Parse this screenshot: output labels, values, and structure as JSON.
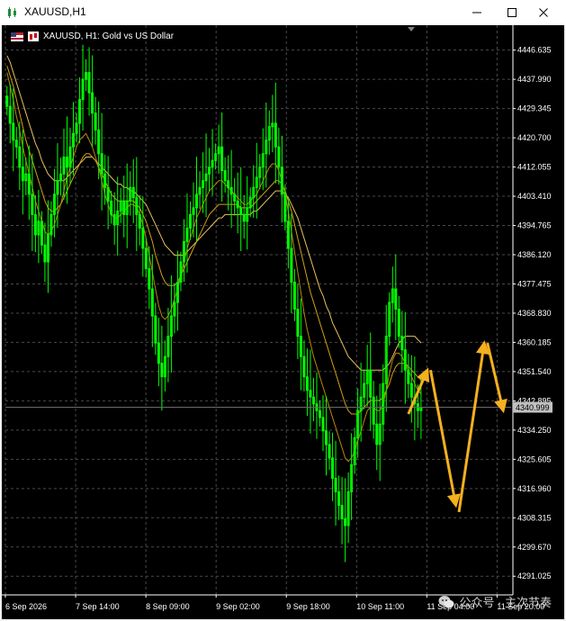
{
  "window": {
    "title": "XAUUSD,H1",
    "icons": {
      "app": "candlestick-chart-icon",
      "minimize": "minimize-icon",
      "maximize": "maximize-icon",
      "close": "close-icon"
    }
  },
  "chart_info": {
    "text": "XAUUSD, H1:  Gold vs US Dollar",
    "icons": [
      "flag-icon",
      "chart-type-icon"
    ]
  },
  "watermark": {
    "text": "公众号 · 主次节奏",
    "icon": "wechat-icon"
  },
  "colors": {
    "background": "#000000",
    "grid": "#4a4a4a",
    "candle": "#00ff00",
    "ma_fast": "#b8860b",
    "ma_mid": "#d2a017",
    "ma_slow": "#e8c060",
    "arrow": "#f5b01f",
    "axis_text": "#ffffff",
    "price_tag_bg": "#c0c0c0",
    "price_tag_text": "#000000",
    "current_line": "#6a6a6a"
  },
  "chart_data": {
    "type": "candlestick",
    "symbol": "XAUUSD",
    "timeframe": "H1",
    "y_ticks": [
      4446.635,
      4437.99,
      4429.345,
      4420.7,
      4412.055,
      4403.41,
      4394.765,
      4386.12,
      4377.475,
      4368.83,
      4360.185,
      4351.54,
      4342.895,
      4334.25,
      4325.605,
      4316.96,
      4308.315,
      4299.67,
      4291.025
    ],
    "y_tick_labels": [
      "4446.635",
      "4437.990",
      "4429.345",
      "4420.700",
      "4412.055",
      "4403.410",
      "4394.765",
      "4386.120",
      "4377.475",
      "4368.830",
      "4360.185",
      "4351.540",
      "4342.895",
      "4334.250",
      "4325.605",
      "4316.960",
      "4308.315",
      "4299.670",
      "4291.025"
    ],
    "ylim": [
      4285.5,
      4454.0
    ],
    "x_labels": [
      "6 Sep 2026",
      "7 Sep 14:00",
      "8 Sep 09:00",
      "9 Sep 02:00",
      "9 Sep 18:00",
      "10 Sep 11:00",
      "11 Sep 04:00",
      "11 Sep 20:00"
    ],
    "current_price": 4340.999,
    "current_price_label": "4340.999",
    "close": [
      4430,
      4425,
      4420,
      4418,
      4412,
      4408,
      4410,
      4404,
      4398,
      4392,
      4396,
      4389,
      4384,
      4392,
      4398,
      4404,
      4408,
      4410,
      4415,
      4412,
      4418,
      4422,
      4425,
      4432,
      4438,
      4440,
      4434,
      4428,
      4423,
      4416,
      4410,
      4406,
      4402,
      4398,
      4395,
      4399,
      4402,
      4398,
      4402,
      4406,
      4403,
      4398,
      4394,
      4388,
      4382,
      4376,
      4368,
      4360,
      4354,
      4350,
      4356,
      4362,
      4368,
      4372,
      4378,
      4384,
      4390,
      4394,
      4398,
      4400,
      4404,
      4406,
      4408,
      4410,
      4412,
      4414,
      4416,
      4418,
      4411,
      4408,
      4406,
      4404,
      4402,
      4400,
      4398,
      4396,
      4400,
      4403,
      4406,
      4409,
      4412,
      4416,
      4420,
      4424,
      4425,
      4418,
      4412,
      4404,
      4396,
      4388,
      4378,
      4370,
      4362,
      4356,
      4350,
      4346,
      4344,
      4342,
      4340,
      4338,
      4334,
      4330,
      4326,
      4320,
      4316,
      4312,
      4308,
      4306,
      4316,
      4324,
      4332,
      4340,
      4344,
      4348,
      4352,
      4344,
      4336,
      4330,
      4336,
      4348,
      4362,
      4372,
      4376,
      4370,
      4362,
      4358,
      4352,
      4348,
      4344,
      4342,
      4340,
      4341
    ],
    "ma_fast": [
      4440,
      4436,
      4432,
      4427,
      4423,
      4418,
      4414,
      4410,
      4406,
      4402,
      4399,
      4396,
      4393,
      4392,
      4393,
      4395,
      4398,
      4401,
      4405,
      4409,
      4412,
      4415,
      4418,
      4420,
      4421,
      4422,
      4420,
      4418,
      4415,
      4412,
      4408,
      4404,
      4401,
      4398,
      4397,
      4397,
      4398,
      4399,
      4400,
      4401,
      4401,
      4400,
      4398,
      4395,
      4391,
      4386,
      4381,
      4376,
      4371,
      4368,
      4367,
      4368,
      4370,
      4373,
      4376,
      4380,
      4384,
      4388,
      4391,
      4394,
      4397,
      4399,
      4401,
      4403,
      4405,
      4406,
      4407,
      4408,
      4408,
      4407,
      4406,
      4405,
      4404,
      4403,
      4402,
      4401,
      4401,
      4402,
      4403,
      4404,
      4406,
      4408,
      4410,
      4412,
      4413,
      4413,
      4411,
      4408,
      4404,
      4399,
      4393,
      4387,
      4381,
      4375,
      4369,
      4364,
      4360,
      4356,
      4353,
      4350,
      4347,
      4344,
      4341,
      4338,
      4335,
      4332,
      4329,
      4326,
      4325,
      4326,
      4328,
      4331,
      4334,
      4337,
      4340,
      4341,
      4341,
      4340,
      4340,
      4342,
      4346,
      4351,
      4355,
      4357,
      4357,
      4356,
      4354,
      4352,
      4350,
      4348,
      4346,
      4345
    ],
    "ma_mid": [
      4442,
      4439,
      4436,
      4432,
      4428,
      4424,
      4420,
      4417,
      4414,
      4411,
      4408,
      4405,
      4402,
      4400,
      4399,
      4399,
      4400,
      4401,
      4403,
      4405,
      4407,
      4409,
      4411,
      4413,
      4415,
      4416,
      4416,
      4415,
      4414,
      4412,
      4410,
      4408,
      4406,
      4404,
      4403,
      4402,
      4402,
      4402,
      4402,
      4402,
      4402,
      4401,
      4400,
      4398,
      4396,
      4393,
      4390,
      4386,
      4383,
      4380,
      4378,
      4377,
      4377,
      4377,
      4378,
      4380,
      4382,
      4384,
      4386,
      4388,
      4390,
      4392,
      4394,
      4396,
      4398,
      4399,
      4400,
      4401,
      4401,
      4401,
      4401,
      4401,
      4401,
      4401,
      4400,
      4400,
      4400,
      4400,
      4401,
      4402,
      4403,
      4404,
      4405,
      4406,
      4407,
      4408,
      4408,
      4407,
      4405,
      4402,
      4399,
      4395,
      4391,
      4387,
      4383,
      4379,
      4375,
      4372,
      4369,
      4366,
      4363,
      4360,
      4357,
      4354,
      4351,
      4348,
      4345,
      4342,
      4340,
      4339,
      4339,
      4339,
      4340,
      4341,
      4342,
      4343,
      4343,
      4343,
      4343,
      4344,
      4346,
      4348,
      4351,
      4353,
      4354,
      4354,
      4354,
      4353,
      4352,
      4351,
      4350,
      4349
    ],
    "ma_slow": [
      4445,
      4443,
      4440,
      4437,
      4434,
      4431,
      4428,
      4425,
      4422,
      4419,
      4417,
      4414,
      4412,
      4410,
      4409,
      4408,
      4408,
      4408,
      4408,
      4409,
      4410,
      4411,
      4412,
      4413,
      4414,
      4415,
      4415,
      4415,
      4414,
      4413,
      4412,
      4411,
      4410,
      4409,
      4408,
      4407,
      4407,
      4406,
      4406,
      4405,
      4405,
      4404,
      4403,
      4402,
      4401,
      4399,
      4397,
      4395,
      4393,
      4391,
      4389,
      4388,
      4387,
      4386,
      4386,
      4386,
      4386,
      4387,
      4388,
      4389,
      4390,
      4391,
      4392,
      4393,
      4394,
      4395,
      4396,
      4397,
      4397,
      4398,
      4398,
      4398,
      4398,
      4398,
      4398,
      4398,
      4398,
      4398,
      4399,
      4399,
      4400,
      4401,
      4402,
      4403,
      4404,
      4405,
      4405,
      4405,
      4404,
      4403,
      4401,
      4399,
      4397,
      4394,
      4391,
      4388,
      4385,
      4382,
      4379,
      4376,
      4374,
      4371,
      4369,
      4366,
      4364,
      4362,
      4360,
      4358,
      4356,
      4355,
      4354,
      4353,
      4352,
      4352,
      4352,
      4352,
      4352,
      4352,
      4352,
      4352,
      4353,
      4354,
      4356,
      4358,
      4360,
      4361,
      4362,
      4362,
      4362,
      4362,
      4361,
      4360
    ],
    "projection_arrows": [
      {
        "from": {
          "x_index": 127,
          "price": 4339
        },
        "to": {
          "x_index": 133,
          "price": 4352
        }
      },
      {
        "from": {
          "x_index": 134,
          "price": 4352
        },
        "to": {
          "x_index": 142,
          "price": 4312
        }
      },
      {
        "from": {
          "x_index": 143,
          "price": 4310
        },
        "to": {
          "x_index": 151,
          "price": 4360
        }
      },
      {
        "from": {
          "x_index": 152,
          "price": 4360
        },
        "to": {
          "x_index": 157,
          "price": 4340
        }
      }
    ]
  }
}
